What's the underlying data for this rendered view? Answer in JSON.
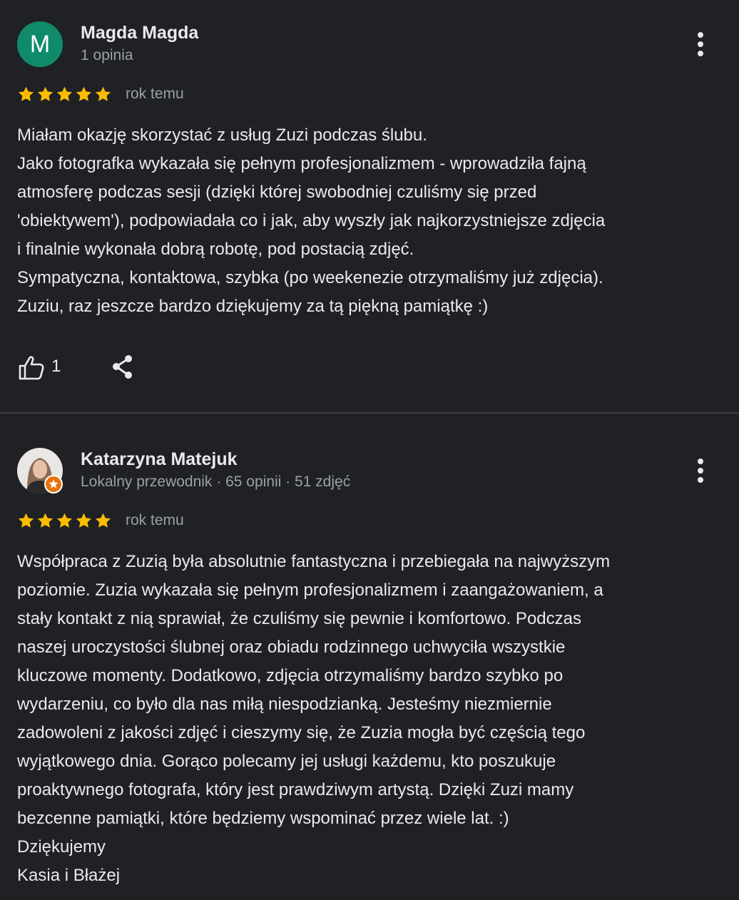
{
  "reviews": [
    {
      "author": "Magda Magda",
      "avatar_letter": "M",
      "avatar_color": "#0f8b6c",
      "meta": "1 opinia",
      "rating": 5,
      "date": "rok temu",
      "text_lines": [
        "Miałam okazję skorzystać z usług Zuzi podczas ślubu.",
        "Jako fotografka wykazała się pełnym profesjonalizmem - wprowadziła fajną",
        "atmosferę podczas sesji (dzięki której swobodniej czuliśmy się przed",
        "'obiektywem'), podpowiadała co i jak, aby wyszły jak najkorzystniejsze zdjęcia",
        "i finalnie wykonała dobrą robotę, pod postacią zdjęć.",
        "Sympatyczna, kontaktowa, szybka (po weekenezie otrzymaliśmy już zdjęcia).",
        "Zuziu, raz jeszcze bardzo dziękujemy za tą piękną pamiątkę :)"
      ],
      "like_count": "1",
      "icons": {
        "like": "thumbs-up-icon",
        "share": "share-icon",
        "more": "more-vert-icon"
      }
    },
    {
      "author": "Katarzyna Matejuk",
      "meta": "Lokalny przewodnik · 65 opinii · 51 zdjęć",
      "local_guide_badge_color": "#e8710a",
      "rating": 5,
      "date": "rok temu",
      "text_lines": [
        "Współpraca z Zuzią była absolutnie fantastyczna i przebiegała na najwyższym",
        "poziomie. Zuzia wykazała się pełnym profesjonalizmem i zaangażowaniem, a",
        "stały kontakt z nią sprawiał, że czuliśmy się pewnie i komfortowo. Podczas",
        "naszej uroczystości ślubnej oraz obiadu rodzinnego uchwyciła wszystkie",
        "kluczowe momenty. Dodatkowo, zdjęcia otrzymaliśmy bardzo szybko po",
        "wydarzeniu, co było dla nas miłą niespodzianką. Jesteśmy niezmiernie",
        "zadowoleni z jakości zdjęć i cieszymy się, że Zuzia mogła być częścią tego",
        "wyjątkowego dnia. Gorąco polecamy jej usługi każdemu, kto poszukuje",
        "proaktywnego fotografa, który jest prawdziwym artystą. Dzięki Zuzi mamy",
        "bezcenne pamiątki, które będziemy wspominać przez wiele lat. :)",
        "Dziękujemy",
        "Kasia i Błażej"
      ],
      "icons": {
        "more": "more-vert-icon"
      }
    }
  ],
  "colors": {
    "background": "#202124",
    "star": "#fbbc04",
    "text": "#e8eaed",
    "secondary_text": "#9aa0a6",
    "divider": "#3c4043"
  }
}
